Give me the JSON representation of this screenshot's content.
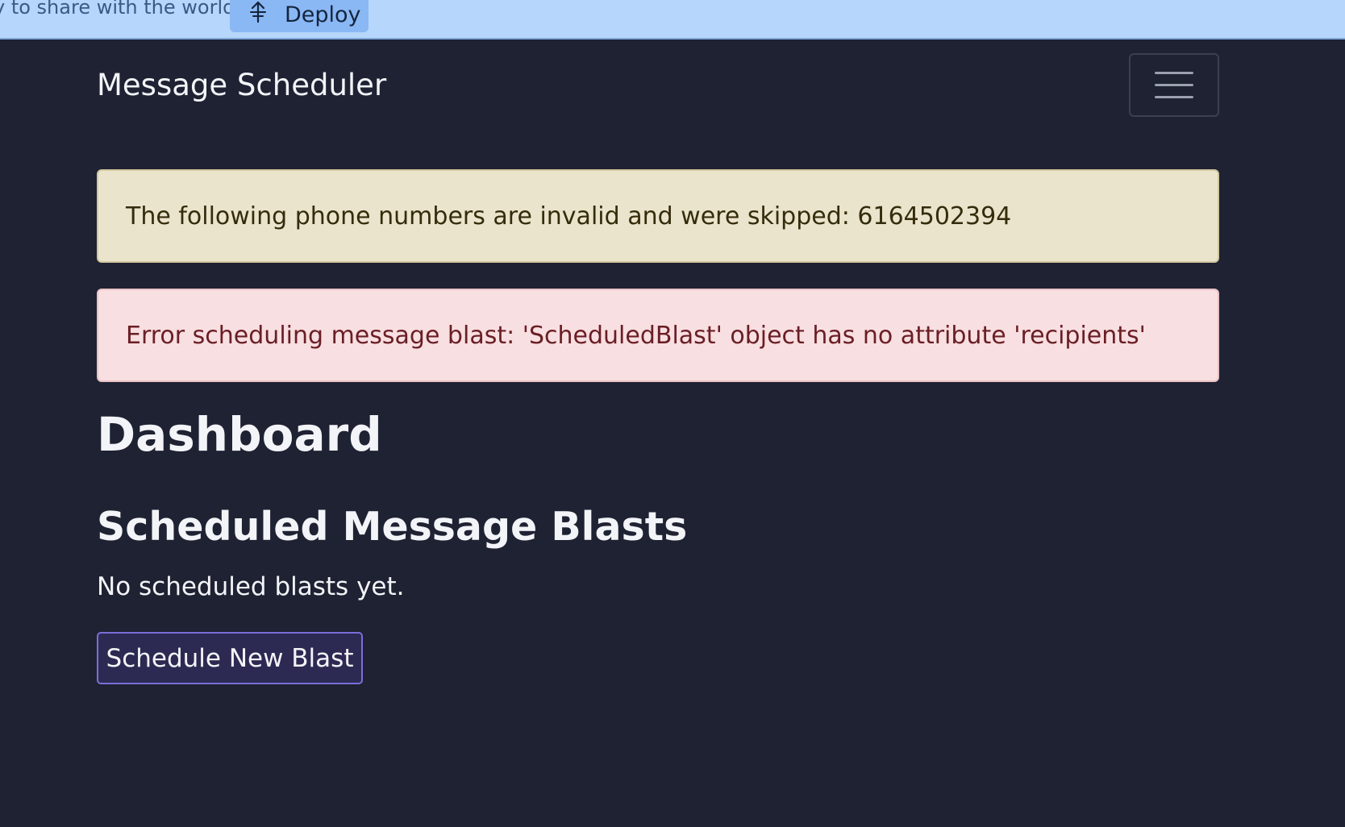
{
  "deploy_bar": {
    "prompt_text": "y to share with the world?",
    "deploy_label": "Deploy",
    "deploy_icon": "deploy-icon"
  },
  "navbar": {
    "brand": "Message Scheduler",
    "toggler_icon": "hamburger-menu-icon"
  },
  "alerts": {
    "warning": "The following phone numbers are invalid and were skipped: 6164502394",
    "error": "Error scheduling message blast: 'ScheduledBlast' object has no attribute 'recipients'"
  },
  "main": {
    "title": "Dashboard",
    "section_title": "Scheduled Message Blasts",
    "empty_message": "No scheduled blasts yet.",
    "schedule_button_label": "Schedule New Blast"
  },
  "colors": {
    "background": "#1e2232",
    "deploy_bar": "#b6d6fb",
    "warning_bg": "#ebe4cd",
    "danger_bg": "#f8dfe1",
    "button_border": "#7b6ed9"
  }
}
